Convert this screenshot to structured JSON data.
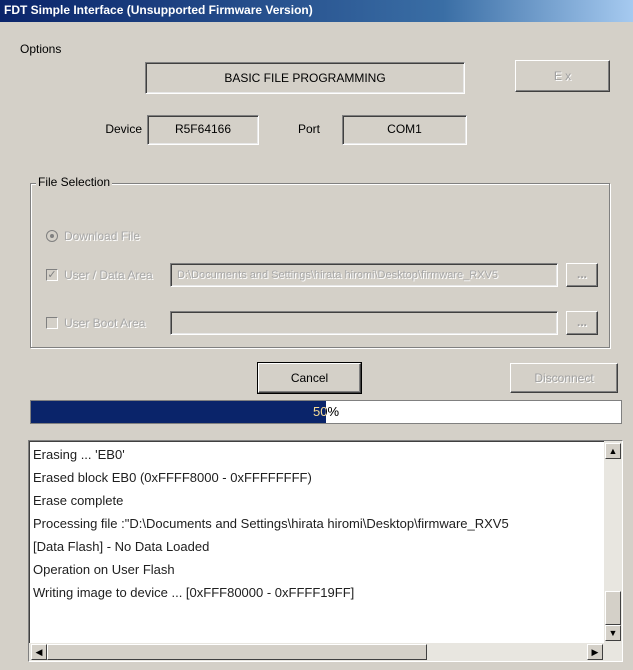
{
  "window": {
    "title": "FDT Simple Interface  (Unsupported Firmware Version)"
  },
  "menu": {
    "options_label": "Options"
  },
  "header": {
    "mode": "BASIC FILE PROGRAMMING",
    "mode_button_label": "E x"
  },
  "device": {
    "label": "Device",
    "value": "R5F64166"
  },
  "port": {
    "label": "Port",
    "value": "COM1"
  },
  "file_selection": {
    "group_label": "File Selection",
    "option1_label": "Download File",
    "option2_label": "User / Data Area",
    "option2_path": "D:\\Documents and Settings\\hirata hiromi\\Desktop\\firmware_RXV5",
    "option3_label": "User Boot Area",
    "option3_path": "",
    "browse_label": "..."
  },
  "actions": {
    "cancel_label": "Cancel",
    "disconnect_label": "Disconnect"
  },
  "progress": {
    "percent": 50,
    "text": "50%"
  },
  "log": {
    "lines": [
      "Erasing ... 'EB0'",
      "Erased block EB0 (0xFFFF8000 - 0xFFFFFFFF)",
      "Erase complete",
      "Processing file :\"D:\\Documents and Settings\\hirata hiromi\\Desktop\\firmware_RXV5",
      "[Data Flash] - No Data Loaded",
      "Operation on User Flash",
      "Writing image to device ... [0xFFF80000 - 0xFFFF19FF]"
    ]
  },
  "icons": {
    "scroll_up": "scroll-up-icon",
    "scroll_down": "scroll-down-icon",
    "scroll_left": "scroll-left-icon",
    "scroll_right": "scroll-right-icon"
  },
  "colors": {
    "title_bar": "#0a246a",
    "progress_fill": "#0a246a",
    "face": "#d4d0c8"
  }
}
